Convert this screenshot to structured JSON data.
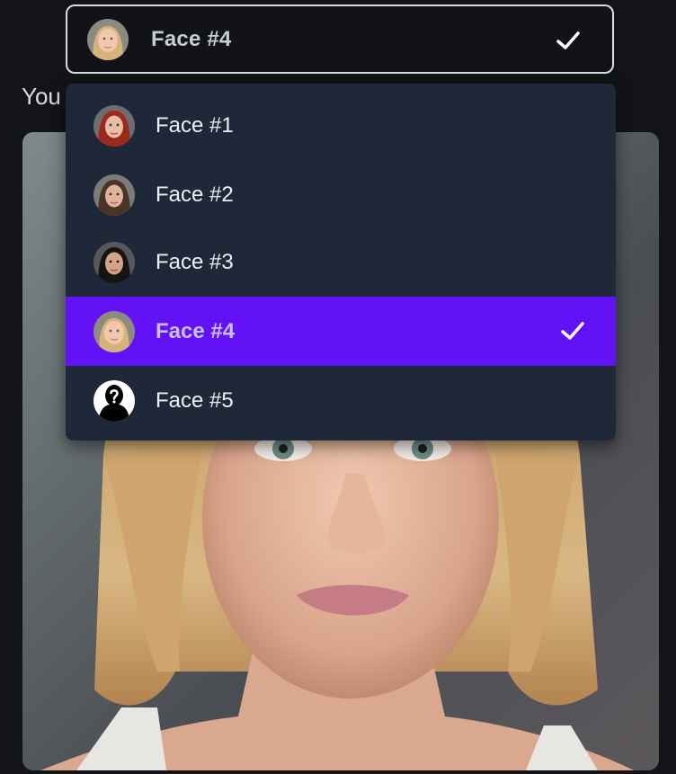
{
  "select": {
    "value": "Face #4",
    "check_icon": "check-icon"
  },
  "section": {
    "label": "You"
  },
  "dropdown": {
    "options": [
      {
        "label": "Face #1",
        "selected": false
      },
      {
        "label": "Face #2",
        "selected": false
      },
      {
        "label": "Face #3",
        "selected": false
      },
      {
        "label": "Face #4",
        "selected": true
      },
      {
        "label": "Face #5",
        "selected": false
      }
    ]
  },
  "colors": {
    "accent": "#6312f5",
    "dropdown_bg": "#1f2838",
    "page_bg": "#121418"
  }
}
